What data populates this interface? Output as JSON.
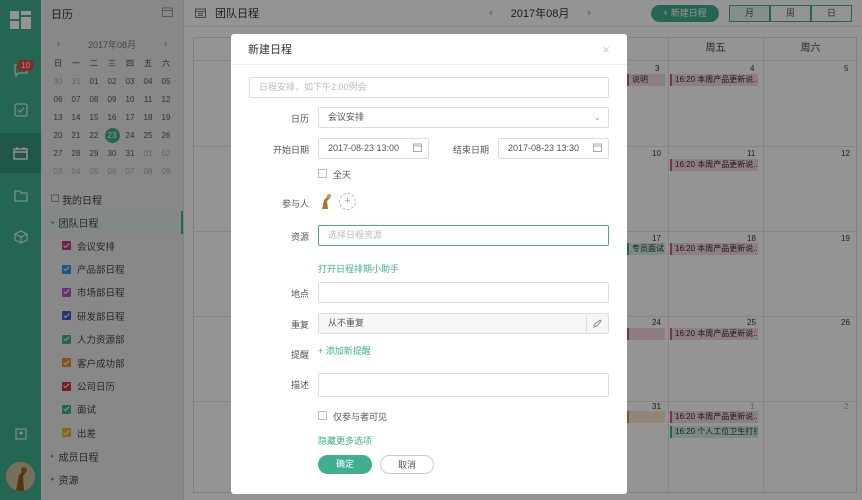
{
  "rail": {
    "badge": "10"
  },
  "sidebar": {
    "title": "日历",
    "mini": {
      "title": "2017年08月",
      "weekdays": [
        "日",
        "一",
        "二",
        "三",
        "四",
        "五",
        "六"
      ],
      "rows": [
        [
          "30",
          "31",
          "01",
          "02",
          "03",
          "04",
          "05"
        ],
        [
          "06",
          "07",
          "08",
          "09",
          "10",
          "11",
          "12"
        ],
        [
          "13",
          "14",
          "15",
          "16",
          "17",
          "18",
          "19"
        ],
        [
          "20",
          "21",
          "22",
          "23",
          "24",
          "25",
          "26"
        ],
        [
          "27",
          "28",
          "29",
          "30",
          "31",
          "01",
          "02"
        ],
        [
          "03",
          "04",
          "05",
          "06",
          "07",
          "08",
          "09"
        ]
      ],
      "today": "23"
    },
    "my_label": "我的日程",
    "team_label": "团队日程",
    "calendars": [
      {
        "label": "会议安排",
        "color": "#c23a7a"
      },
      {
        "label": "产品部日程",
        "color": "#3a8fd6"
      },
      {
        "label": "市场部日程",
        "color": "#b84fc9"
      },
      {
        "label": "研发部日程",
        "color": "#3a5fc9"
      },
      {
        "label": "人力资源部",
        "color": "#3fae91"
      },
      {
        "label": "客户成功部",
        "color": "#e0912f"
      },
      {
        "label": "公司日历",
        "color": "#c8323a"
      },
      {
        "label": "面试",
        "color": "#3fae91"
      },
      {
        "label": "出差",
        "color": "#e6b52f"
      }
    ],
    "member_label": "成员日程",
    "resource_label": "资源"
  },
  "toolbar": {
    "title": "团队日程",
    "month": "2017年08月",
    "new_button": "+ 新建日程",
    "views": [
      "月",
      "周",
      "日"
    ]
  },
  "calendar": {
    "days": [
      "周五",
      "周六"
    ],
    "rows": [
      {
        "left": "3",
        "fri": "4",
        "sat": "5"
      },
      {
        "left": "10",
        "fri": "11",
        "sat": "12"
      },
      {
        "left": "17",
        "fri": "18",
        "sat": "19"
      },
      {
        "left": "24",
        "fri": "25",
        "sat": "26"
      },
      {
        "left": "31",
        "fri": "1",
        "sat": "2"
      }
    ],
    "events": {
      "left1": "说明",
      "fri_event": "16:20 本周产品更新说...",
      "left3": "专员面试",
      "fri_event2": "16:20 个人工位卫生打扫..."
    }
  },
  "modal": {
    "title": "新建日程",
    "close": "×",
    "summary_placeholder": "日程安排，如下午2:00例会",
    "calendar_label": "日历",
    "calendar_value": "会议安排",
    "start_label": "开始日期",
    "start_value": "2017-08-23 13:00",
    "end_label": "结束日期",
    "end_value": "2017-08-23 13:30",
    "allday_label": "全天",
    "participants_label": "参与人",
    "resource_label": "资源",
    "resource_placeholder": "选择日程资源",
    "assistant_link": "打开日程排期小助手",
    "location_label": "地点",
    "repeat_label": "重复",
    "repeat_value": "从不重复",
    "remind_label": "提醒",
    "add_remind": "+ 添加新提醒",
    "desc_label": "描述",
    "visible_label": "仅参与者可见",
    "hide_more": "隐藏更多选项",
    "confirm": "确定",
    "cancel": "取消"
  }
}
